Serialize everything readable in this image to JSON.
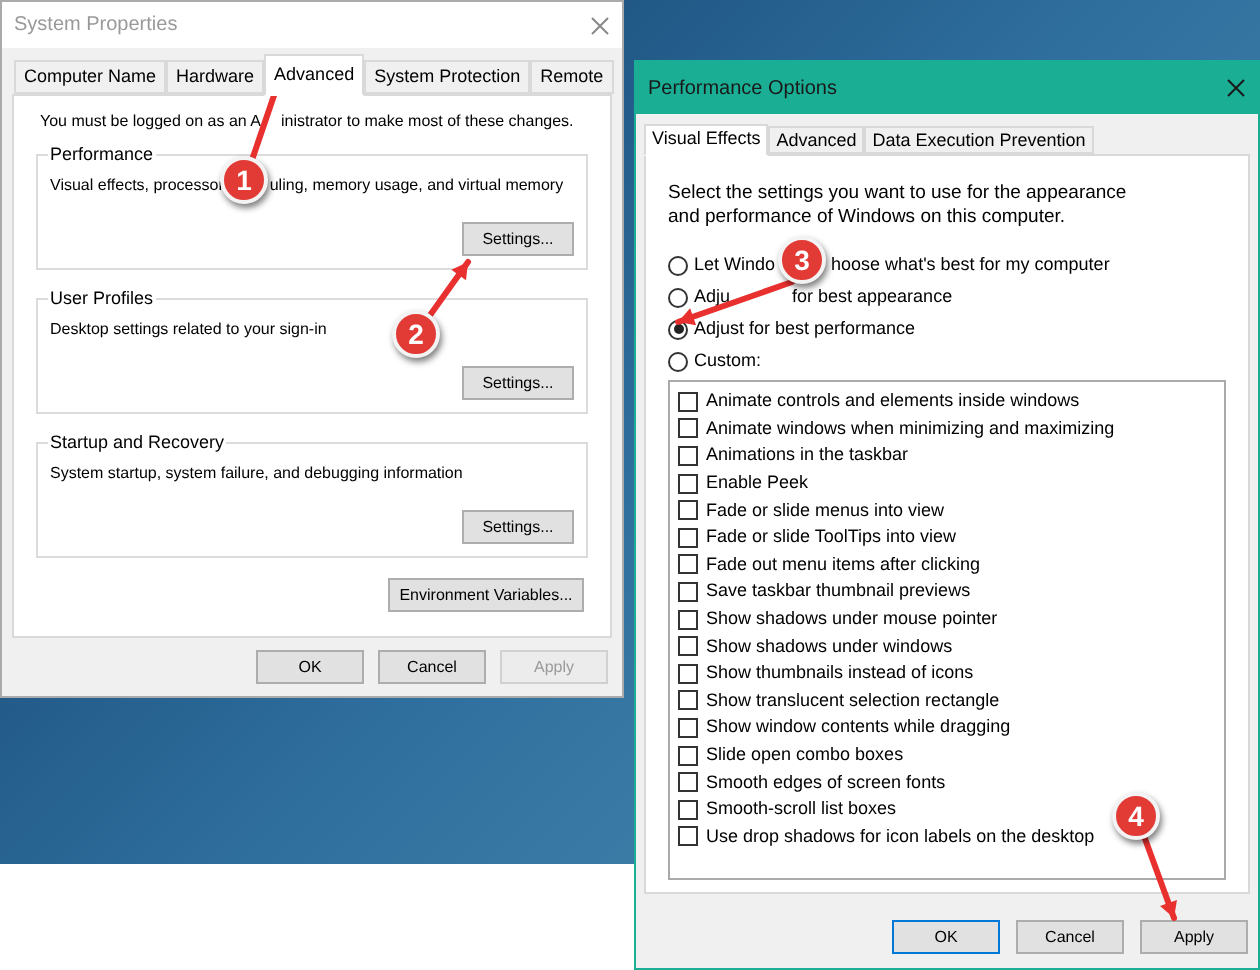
{
  "system_properties": {
    "title": "System Properties",
    "tabs": [
      {
        "label": "Computer Name",
        "selected": false
      },
      {
        "label": "Hardware",
        "selected": false
      },
      {
        "label": "Advanced",
        "selected": true
      },
      {
        "label": "System Protection",
        "selected": false
      },
      {
        "label": "Remote",
        "selected": false
      }
    ],
    "notice": [
      "You must be logged on as an A",
      "inistrator to make most of these changes."
    ],
    "groups": [
      {
        "title": "Performance",
        "description": [
          "Visual effects, processor",
          "uling, memory usage, and virtual memory"
        ],
        "button": "Settings..."
      },
      {
        "title": "User Profiles",
        "description": [
          "Desktop settings related to your sign-in"
        ],
        "button": "Settings..."
      },
      {
        "title": "Startup and Recovery",
        "description": [
          "System startup, system failure, and debugging information"
        ],
        "button": "Settings..."
      }
    ],
    "environment_button": "Environment Variables...",
    "buttons": [
      {
        "label": "OK",
        "disabled": false
      },
      {
        "label": "Cancel",
        "disabled": false
      },
      {
        "label": "Apply",
        "disabled": true
      }
    ]
  },
  "performance_options": {
    "title": "Performance Options",
    "tabs": [
      {
        "label": "Visual Effects",
        "selected": true
      },
      {
        "label": "Advanced",
        "selected": false
      },
      {
        "label": "Data Execution Prevention",
        "selected": false
      }
    ],
    "intro": "Select the settings you want to use for the appearance and performance of Windows on this computer.",
    "options": [
      {
        "label": [
          "Let Windo",
          "hoose what's best for my computer"
        ],
        "selected": false
      },
      {
        "label": [
          "Adju",
          "for best appearance"
        ],
        "selected": false
      },
      {
        "label": [
          "Adjust for best performance"
        ],
        "selected": true
      },
      {
        "label": [
          "Custom:"
        ],
        "selected": false
      }
    ],
    "effects": [
      {
        "label": "Animate controls and elements inside windows",
        "checked": false
      },
      {
        "label": "Animate windows when minimizing and maximizing",
        "checked": false
      },
      {
        "label": "Animations in the taskbar",
        "checked": false
      },
      {
        "label": "Enable Peek",
        "checked": false
      },
      {
        "label": "Fade or slide menus into view",
        "checked": false
      },
      {
        "label": "Fade or slide ToolTips into view",
        "checked": false
      },
      {
        "label": "Fade out menu items after clicking",
        "checked": false
      },
      {
        "label": "Save taskbar thumbnail previews",
        "checked": false
      },
      {
        "label": "Show shadows under mouse pointer",
        "checked": false
      },
      {
        "label": "Show shadows under windows",
        "checked": false
      },
      {
        "label": "Show thumbnails instead of icons",
        "checked": false
      },
      {
        "label": "Show translucent selection rectangle",
        "checked": false
      },
      {
        "label": "Show window contents while dragging",
        "checked": false
      },
      {
        "label": "Slide open combo boxes",
        "checked": false
      },
      {
        "label": "Smooth edges of screen fonts",
        "checked": false
      },
      {
        "label": "Smooth-scroll list boxes",
        "checked": false
      },
      {
        "label": "Use drop shadows for icon labels on the desktop",
        "checked": false
      }
    ],
    "buttons": [
      {
        "label": "OK",
        "default": true
      },
      {
        "label": "Cancel",
        "default": false
      },
      {
        "label": "Apply",
        "default": false
      }
    ]
  },
  "annotations": [
    {
      "label": "1"
    },
    {
      "label": "2"
    },
    {
      "label": "3"
    },
    {
      "label": "4"
    }
  ]
}
